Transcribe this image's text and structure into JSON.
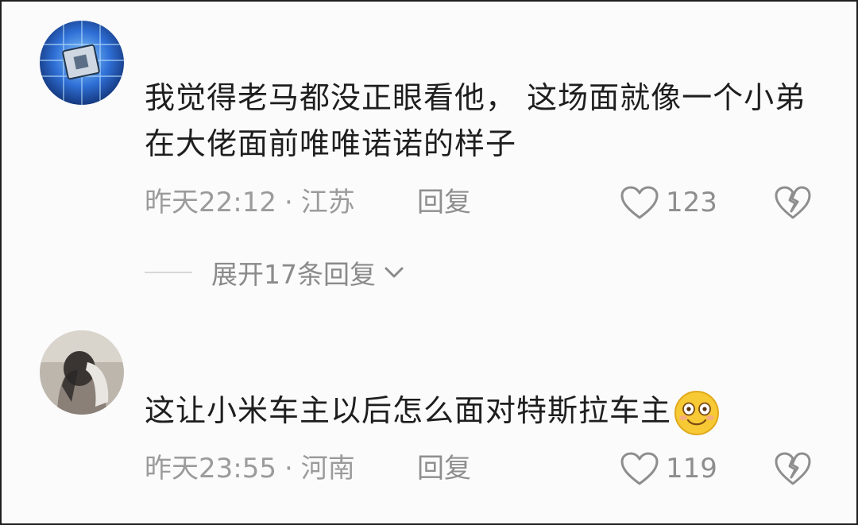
{
  "comments": [
    {
      "text": "我觉得老马都没正眼看他， 这场面就像一个小弟在大佬面前唯唯诺诺的样子",
      "time": "昨天22:12",
      "sep": "·",
      "location": "江苏",
      "reply": "回复",
      "likes": "123",
      "avatar_icon": "chip-avatar-icon"
    },
    {
      "text": "这让小米车主以后怎么面对特斯拉车主",
      "emoji": "smile-emoji-icon",
      "time": "昨天23:55",
      "sep": "·",
      "location": "河南",
      "reply": "回复",
      "likes": "119",
      "avatar_icon": "person-avatar-icon"
    }
  ],
  "expand_replies": "展开17条回复",
  "colors": {
    "text": "#1e1e1e",
    "meta": "#9b9b9b",
    "icon": "#8e8e8e",
    "avatar_blue": "#2f6fd6",
    "emoji_yellow": "#f7c934"
  }
}
